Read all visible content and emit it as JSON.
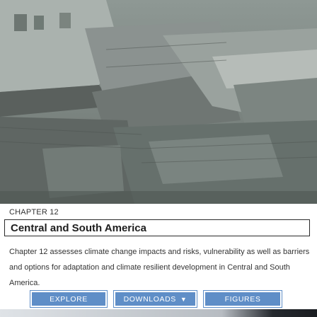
{
  "chapter": {
    "label": "CHAPTER 12",
    "title": "Central and South America",
    "summary": "Chapter 12 assesses climate change impacts and risks, vulnerability as well as barriers and options for adaptation and climate resilient development in Central and South America."
  },
  "actions": {
    "explore": "EXPLORE",
    "downloads": "DOWNLOADS",
    "downloads_icon": "chevron-down-icon",
    "figures": "FIGURES"
  },
  "colors": {
    "button_bg": "#5f8ec7",
    "hero_tone": "#6f7873"
  }
}
